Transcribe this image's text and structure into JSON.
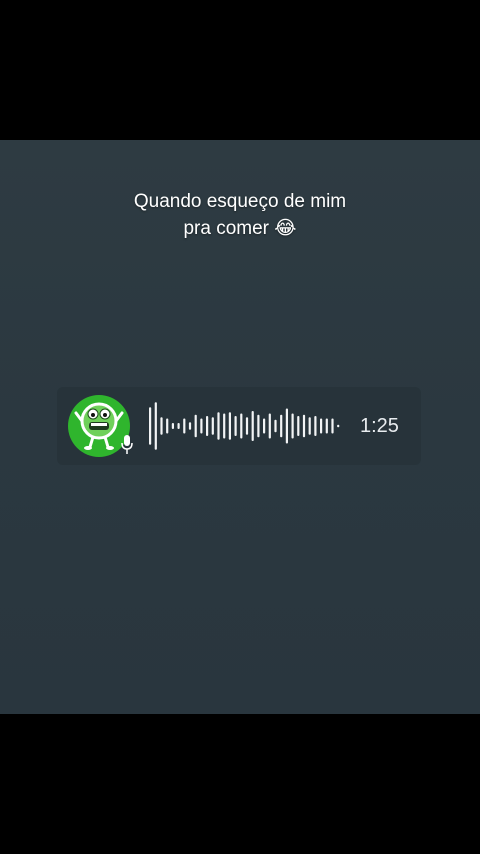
{
  "caption": {
    "line1": "Quando esqueço de mim",
    "line2": "pra comer 😂"
  },
  "voice_message": {
    "duration": "1:25",
    "avatar_icon": "green-cartoon-monster-icon",
    "mic_icon": "microphone-icon",
    "waveform_levels": [
      0.75,
      0.95,
      0.35,
      0.3,
      0.12,
      0.12,
      0.3,
      0.15,
      0.45,
      0.3,
      0.4,
      0.35,
      0.55,
      0.5,
      0.55,
      0.4,
      0.5,
      0.35,
      0.6,
      0.45,
      0.3,
      0.5,
      0.25,
      0.45,
      0.7,
      0.5,
      0.4,
      0.45,
      0.35,
      0.4,
      0.3,
      0.3,
      0.3,
      0.05
    ]
  },
  "colors": {
    "background": "#2c3940",
    "avatar_green": "#2fb52d",
    "waveform": "#f2f4f5"
  }
}
